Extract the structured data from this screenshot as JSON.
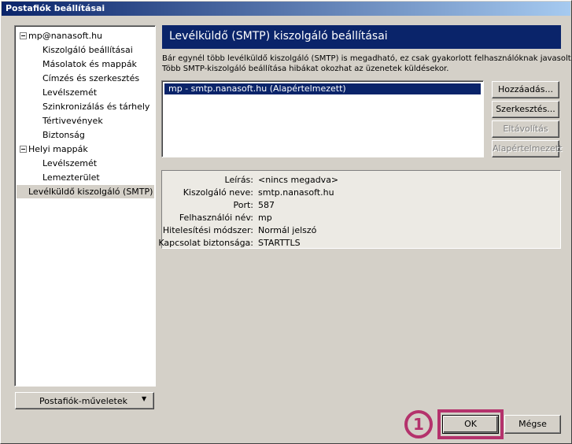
{
  "window": {
    "title": "Postafiók beállításai"
  },
  "tree": {
    "account": "mp@nanasoft.hu",
    "account_items": [
      "Kiszolgáló beállításai",
      "Másolatok és mappák",
      "Címzés és szerkesztés",
      "Levélszemét",
      "Szinkronizálás és tárhely",
      "Tértivevények",
      "Biztonság"
    ],
    "local": "Helyi mappák",
    "local_items": [
      "Levélszemét",
      "Lemezterület"
    ],
    "smtp": "Levélküldő kiszolgáló (SMTP)"
  },
  "panel": {
    "title": "Levélküldő (SMTP) kiszolgáló beállításai",
    "desc1": "Bár egynél több levélküldő kiszolgáló (SMTP) is megadható, ez csak gyakorlott felhasználóknak javasolt.",
    "desc2": "Több SMTP-kiszolgáló beállítása hibákat okozhat az üzenetek küldésekor.",
    "servers": [
      "mp - smtp.nanasoft.hu (Alapértelmezett)"
    ],
    "buttons": {
      "add": "Hozzáadás...",
      "edit": "Szerkesztés...",
      "remove": "Eltávolítás",
      "default": "Alapértelmezett"
    },
    "details": [
      {
        "label": "Leírás:",
        "value": "<nincs megadva>"
      },
      {
        "label": "Kiszolgáló neve:",
        "value": "smtp.nanasoft.hu"
      },
      {
        "label": "Port:",
        "value": "587"
      },
      {
        "label": "Felhasználói név:",
        "value": "mp"
      },
      {
        "label": "Hitelesítési módszer:",
        "value": "Normál jelszó"
      },
      {
        "label": "Kapcsolat biztonsága:",
        "value": "STARTTLS"
      }
    ]
  },
  "accounts_button": "Postafiók-műveletek",
  "footer": {
    "ok": "OK",
    "cancel": "Mégse",
    "callout": "1"
  },
  "colors": {
    "accent": "#b4326c",
    "header": "#0a246a"
  }
}
